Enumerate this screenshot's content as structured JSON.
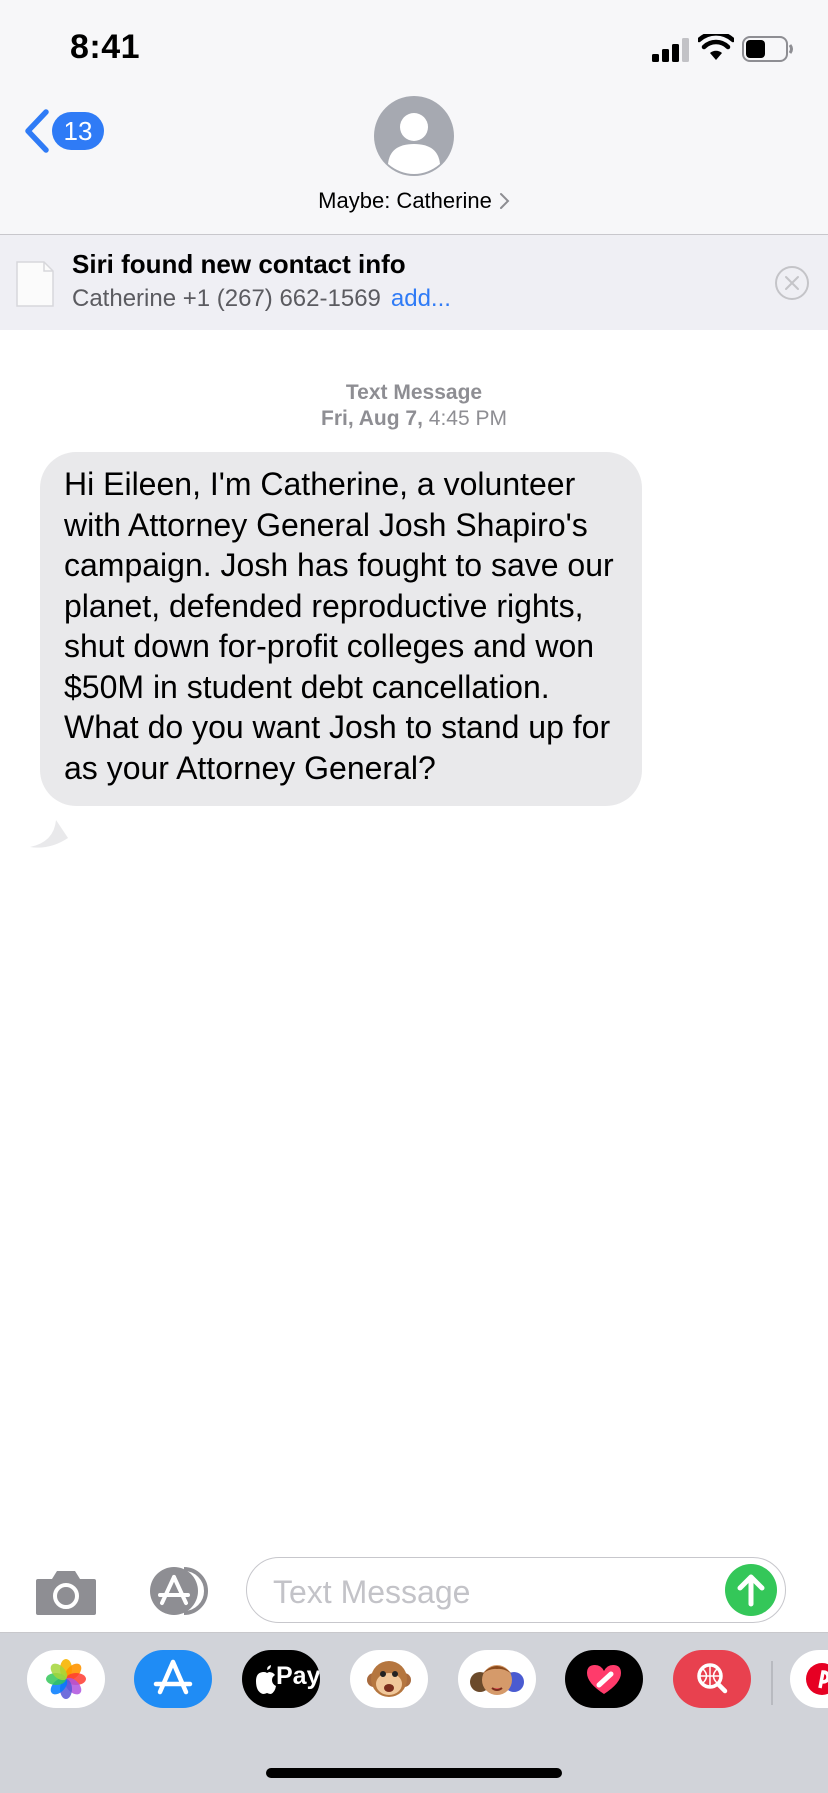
{
  "status_bar": {
    "time": "8:41"
  },
  "nav": {
    "back_badge": "13",
    "contact_name": "Maybe: Catherine"
  },
  "siri_suggestion": {
    "title": "Siri found new contact info",
    "subtitle": "Catherine +1 (267) 662-1569",
    "add_label": "add..."
  },
  "conversation": {
    "service_label": "Text Message",
    "date_label": "Fri, Aug 7,",
    "time_label": "4:45 PM",
    "messages": [
      {
        "direction": "incoming",
        "text": "Hi Eileen, I'm Catherine, a volunteer with Attorney General Josh Shapiro's campaign. Josh has fought to save our planet, defended reproductive rights, shut down for-profit colleges and won $50M in student debt cancellation. What do you want Josh to stand up for as your Attorney General?"
      }
    ]
  },
  "input": {
    "placeholder": "Text Message"
  },
  "app_drawer": {
    "apps": [
      {
        "icon": "photos-app-icon"
      },
      {
        "icon": "app-store-icon"
      },
      {
        "icon": "apple-pay-icon",
        "label": "Pay"
      },
      {
        "icon": "animoji-monkey-icon"
      },
      {
        "icon": "memoji-stickers-icon"
      },
      {
        "icon": "digital-touch-heart-icon"
      },
      {
        "icon": "images-search-icon"
      },
      {
        "icon": "pinterest-icon"
      }
    ]
  },
  "colors": {
    "accent_blue": "#2f7bf6",
    "send_green": "#34c759",
    "incoming_bubble": "#e9e9eb",
    "bar_background": "#f7f7f9",
    "drawer_background": "#d1d3d9"
  }
}
